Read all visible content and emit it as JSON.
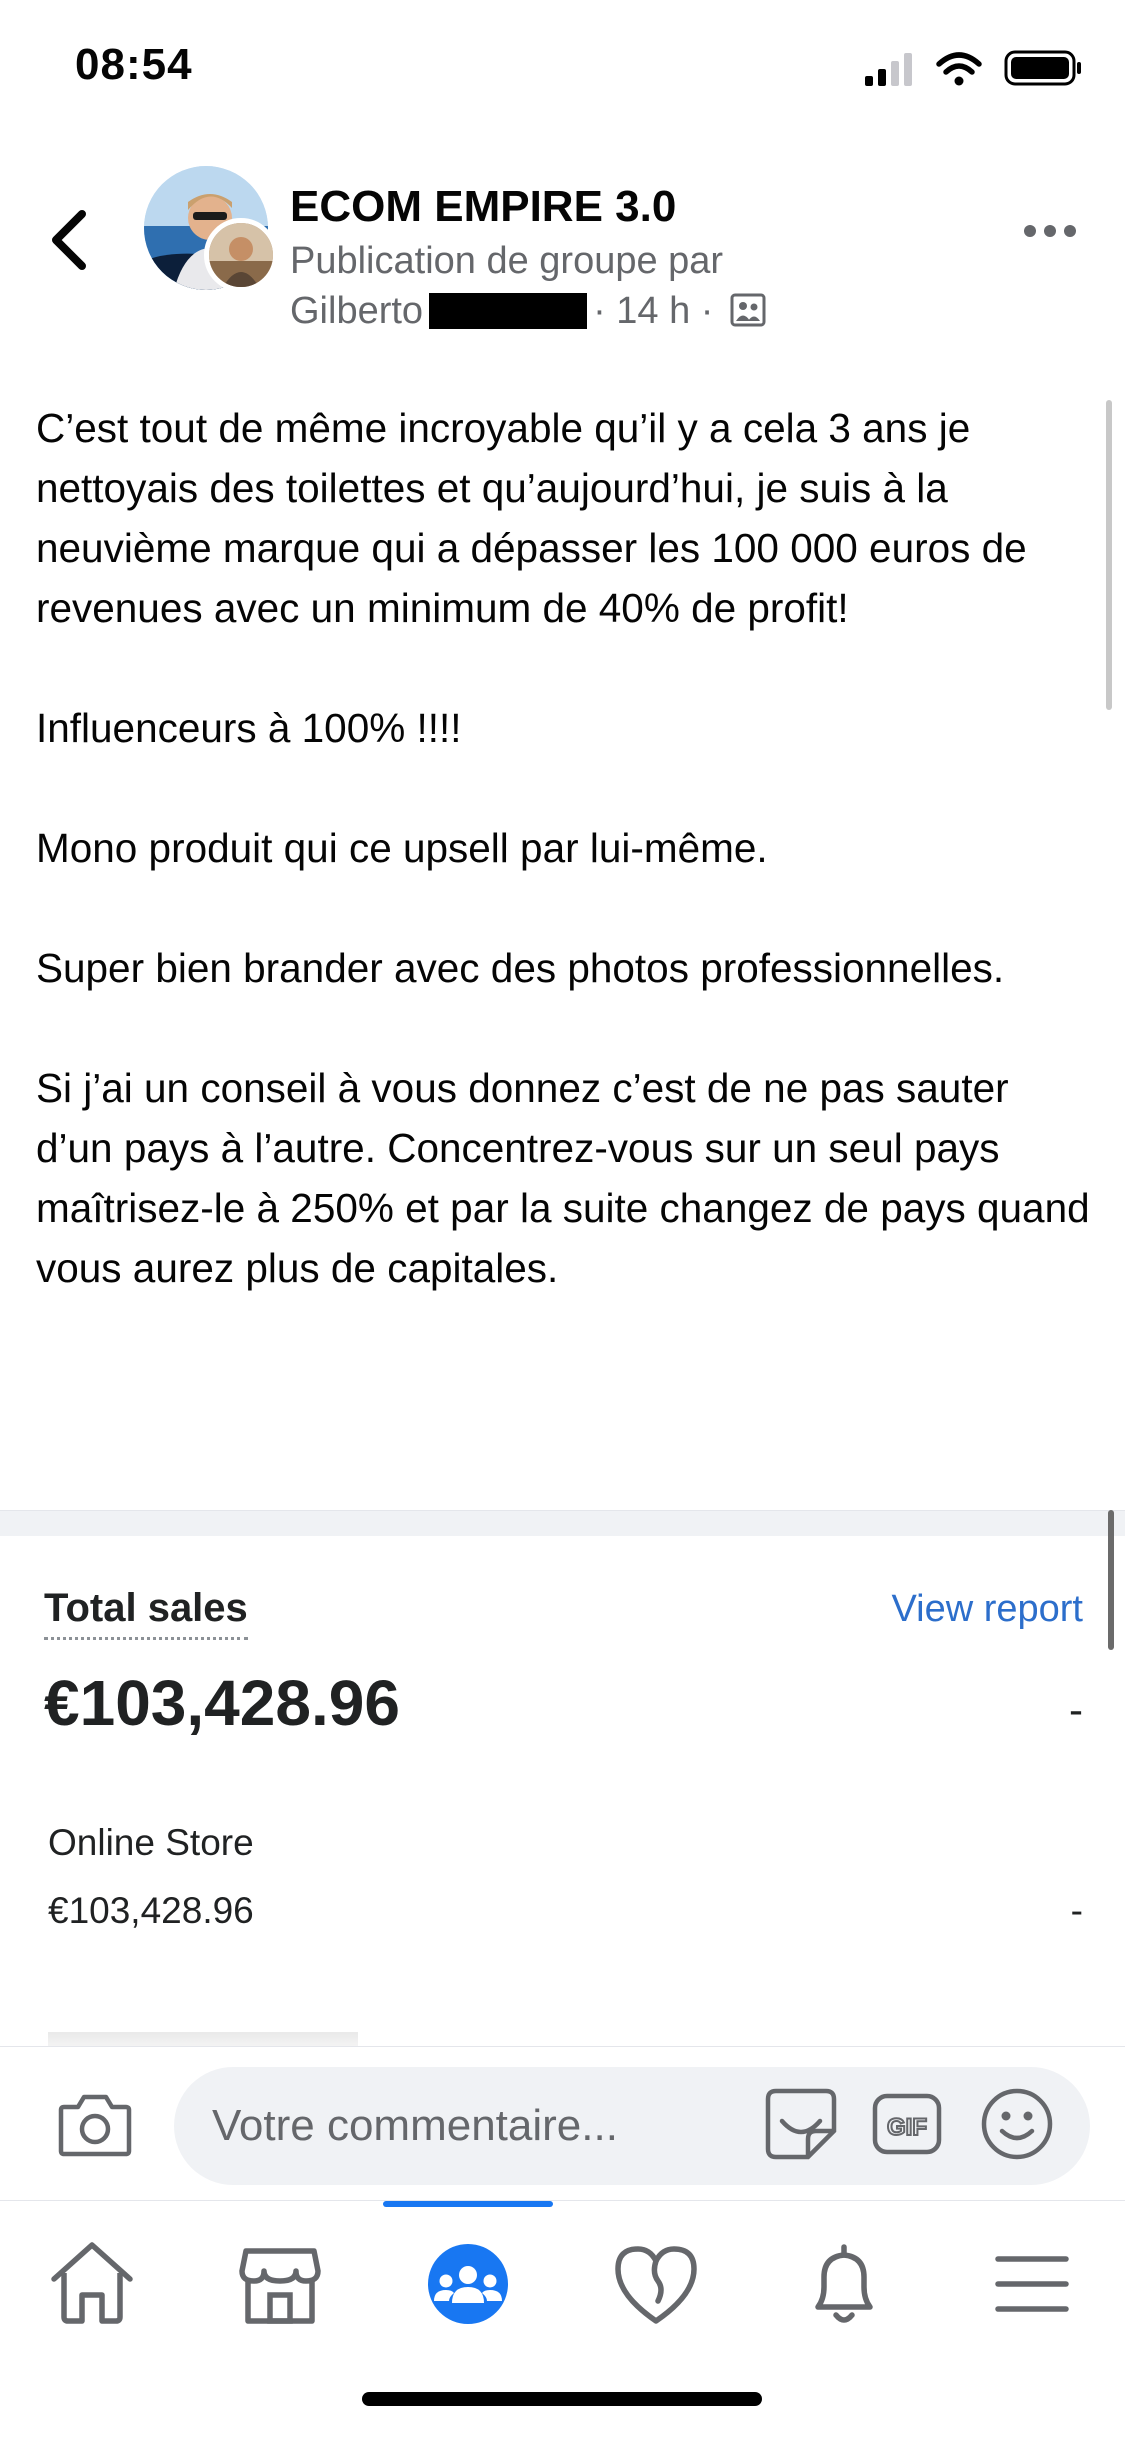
{
  "status_bar": {
    "time": "08:54"
  },
  "header": {
    "group_name": "ECOM EMPIRE 3.0",
    "subtitle": "Publication de groupe par",
    "author": "Gilberto",
    "time_ago": "· 14 h ·"
  },
  "post": {
    "paragraphs": [
      "C’est tout de même incroyable qu’il y a cela 3 ans je nettoyais des toilettes et qu’aujourd’hui, je suis à la neuvième marque qui a dépasser les 100 000 euros de revenues avec un minimum de 40% de profit!",
      "Influenceurs à 100% !!!!",
      "Mono produit qui ce upsell par lui-même.",
      "Super bien brander avec des photos professionnelles.",
      "Si j’ai un conseil à vous donnez c’est de ne pas sauter d’un pays à l’autre. Concentrez-vous sur un seul pays maîtrisez-le à 250% et par la suite changez de pays quand vous aurez plus de capitales."
    ]
  },
  "screenshot": {
    "title": "Total sales",
    "report_link": "View report",
    "total": "€103,428.96",
    "total_change": "-",
    "store_label": "Online Store",
    "store_value": "€103,428.96",
    "store_change": "-"
  },
  "comment_bar": {
    "placeholder": "Votre commentaire..."
  },
  "nav": {
    "items": [
      "home",
      "marketplace",
      "groups",
      "dating",
      "notifications",
      "menu"
    ],
    "active": "groups"
  },
  "colors": {
    "accent": "#1877f2",
    "link": "#2c6ecb",
    "muted": "#65676b"
  }
}
